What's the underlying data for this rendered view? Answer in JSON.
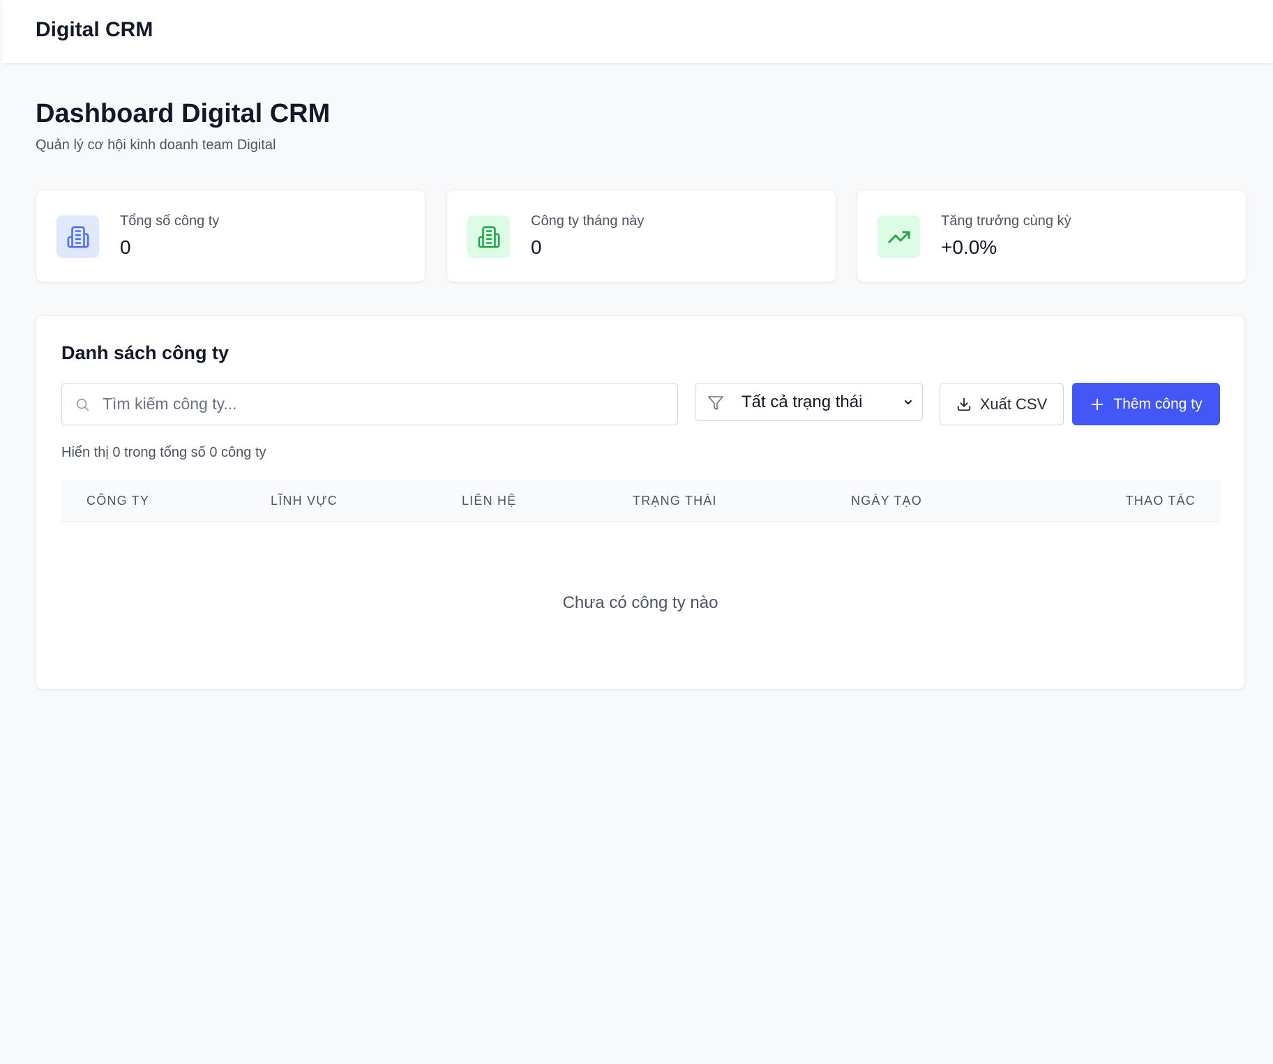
{
  "header": {
    "brand": "Digital CRM"
  },
  "page": {
    "title": "Dashboard Digital CRM",
    "subtitle": "Quản lý cơ hội kinh doanh team Digital"
  },
  "stats": [
    {
      "label": "Tổng số công ty",
      "value": "0",
      "icon": "building-icon",
      "color": "#4f6ef7",
      "bg": "#e0e8fd"
    },
    {
      "label": "Công ty tháng này",
      "value": "0",
      "icon": "building-icon",
      "color": "#22a447",
      "bg": "#dcfce5"
    },
    {
      "label": "Tăng trưởng cùng kỳ",
      "value": "+0.0%",
      "icon": "trending-up-icon",
      "color": "#22a447",
      "bg": "#dcfce5"
    }
  ],
  "companies": {
    "title": "Danh sách công ty",
    "search": {
      "placeholder": "Tìm kiếm công ty...",
      "value": ""
    },
    "filter": {
      "selected": "Tất cả trạng thái"
    },
    "export_label": "Xuất CSV",
    "add_label": "Thêm công ty",
    "count_text": "Hiển thị 0 trong tổng số 0 công ty",
    "columns": [
      "CÔNG TY",
      "LĨNH VỰC",
      "LIÊN HỆ",
      "TRẠNG THÁI",
      "NGÀY TẠO",
      "THAO TÁC"
    ],
    "rows": [],
    "empty_text": "Chưa có công ty nào"
  },
  "colors": {
    "primary": "#4257f5",
    "background": "#f8f9fb"
  }
}
